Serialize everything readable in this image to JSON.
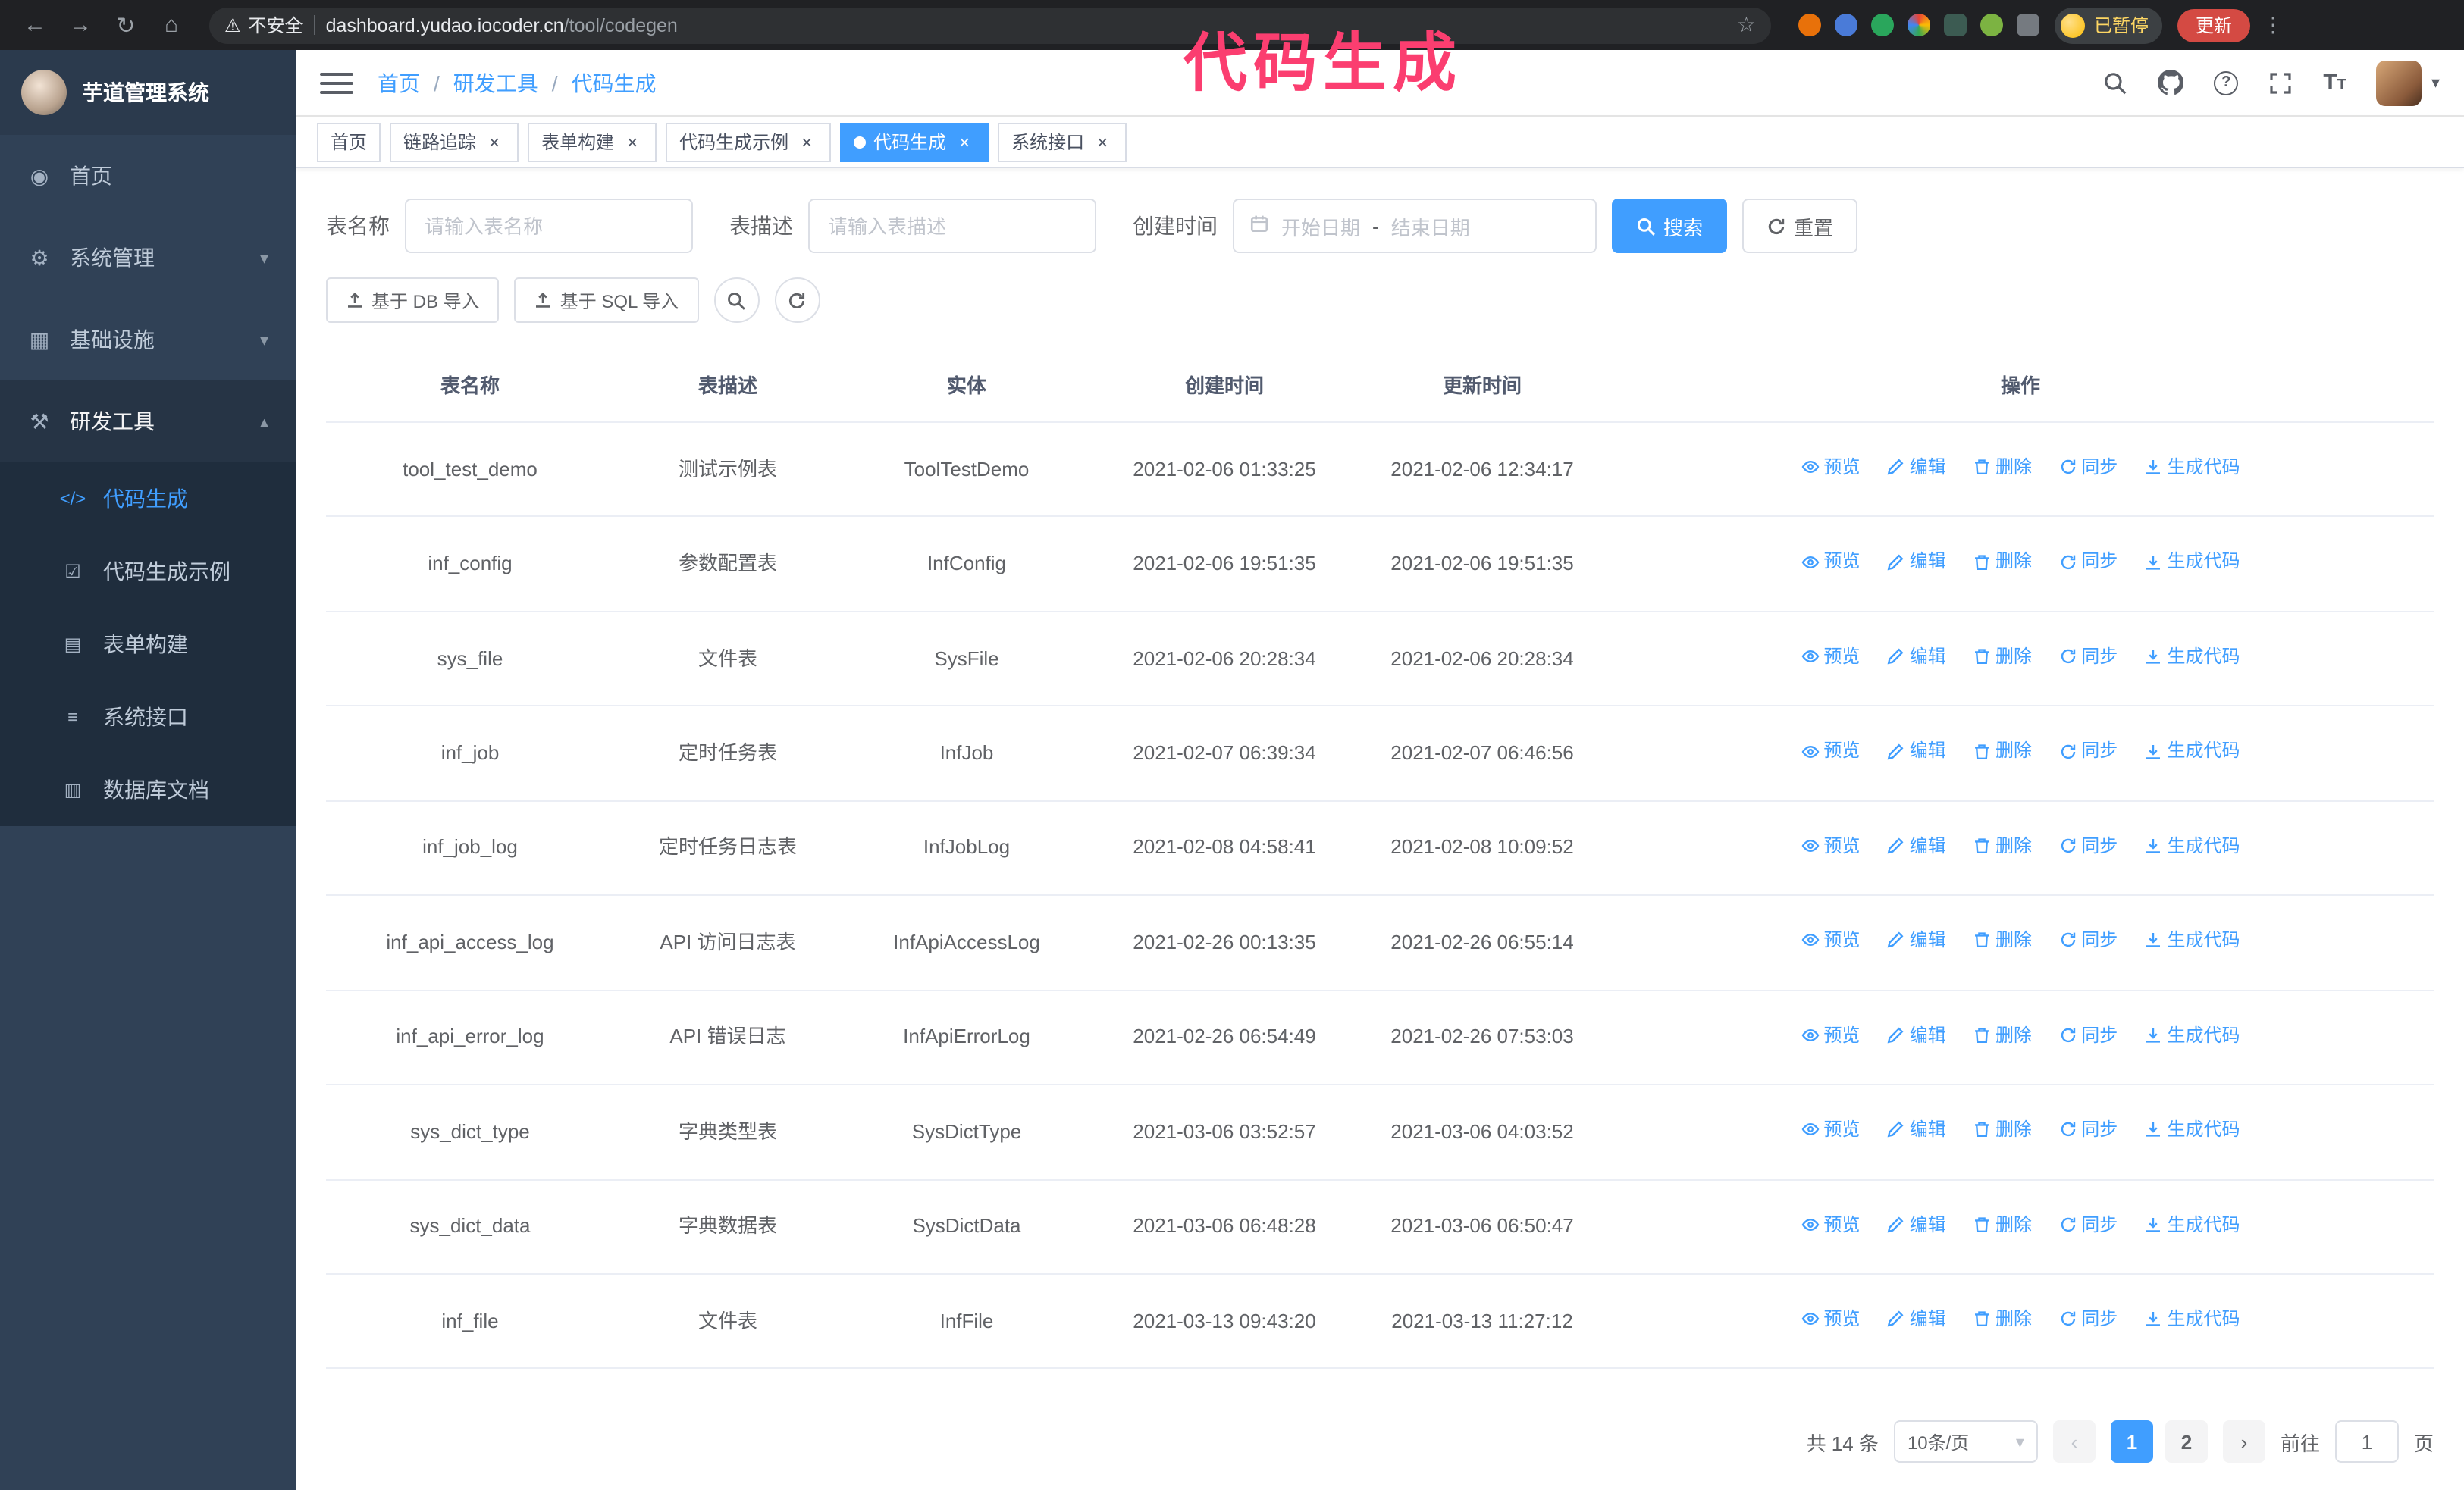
{
  "theme": {
    "primary": "#409eff",
    "annotation": "#fb3e70",
    "browser_bg": "#202124",
    "sidebar_bg": "#304156",
    "submenu_bg": "#1f2d3d",
    "sidebar_text": "#bfcbd9"
  },
  "browser": {
    "security_label": "不安全",
    "url_host": "dashboard.yudao.iocoder.cn",
    "url_path": "/tool/codegen",
    "paused_badge": "已暂停",
    "update_button": "更新"
  },
  "annotation": {
    "text": "代码生成"
  },
  "icons": {
    "back": "←",
    "forward": "→",
    "reload": "↻",
    "home": "⌂",
    "warning": "⚠",
    "star": "☆",
    "kebab": "⋮",
    "close": "×",
    "caret_down": "▾",
    "chevron_left": "‹",
    "chevron_right": "›",
    "question": "?",
    "font_large": "T",
    "font_small": "T"
  },
  "sidebar": {
    "logo_title": "芋道管理系统",
    "menu": [
      {
        "label": "首页",
        "icon": "◉"
      },
      {
        "label": "系统管理",
        "icon": "⚙",
        "chevron": "▾"
      },
      {
        "label": "基础设施",
        "icon": "▦",
        "chevron": "▾"
      },
      {
        "label": "研发工具",
        "icon": "⚒",
        "chevron": "▴",
        "expanded": true
      }
    ],
    "submenu": [
      {
        "label": "代码生成",
        "icon": "</>",
        "active": true
      },
      {
        "label": "代码生成示例",
        "icon": "☑"
      },
      {
        "label": "表单构建",
        "icon": "▤"
      },
      {
        "label": "系统接口",
        "icon": "≡"
      },
      {
        "label": "数据库文档",
        "icon": "▥"
      }
    ]
  },
  "header": {
    "breadcrumb": [
      {
        "label": "首页"
      },
      {
        "label": "研发工具"
      },
      {
        "label": "代码生成"
      }
    ]
  },
  "tabs": [
    {
      "label": "首页"
    },
    {
      "label": "链路追踪",
      "closable": true
    },
    {
      "label": "表单构建",
      "closable": true
    },
    {
      "label": "代码生成示例",
      "closable": true
    },
    {
      "label": "代码生成",
      "closable": true,
      "active": true
    },
    {
      "label": "系统接口",
      "closable": true
    }
  ],
  "filters": {
    "table_name_label": "表名称",
    "table_name_placeholder": "请输入表名称",
    "table_desc_label": "表描述",
    "table_desc_placeholder": "请输入表描述",
    "create_time_label": "创建时间",
    "date_start_placeholder": "开始日期",
    "date_separator": "-",
    "date_end_placeholder": "结束日期",
    "search_button": "搜索",
    "reset_button": "重置"
  },
  "toolbar": {
    "import_db_button": "基于 DB 导入",
    "import_sql_button": "基于 SQL 导入"
  },
  "table": {
    "columns": [
      "表名称",
      "表描述",
      "实体",
      "创建时间",
      "更新时间",
      "操作"
    ],
    "actions": [
      "预览",
      "编辑",
      "删除",
      "同步",
      "生成代码"
    ],
    "rows": [
      {
        "name": "tool_test_demo",
        "desc": "测试示例表",
        "entity": "ToolTestDemo",
        "created": "2021-02-06 01:33:25",
        "updated": "2021-02-06 12:34:17"
      },
      {
        "name": "inf_config",
        "desc": "参数配置表",
        "entity": "InfConfig",
        "created": "2021-02-06 19:51:35",
        "updated": "2021-02-06 19:51:35"
      },
      {
        "name": "sys_file",
        "desc": "文件表",
        "entity": "SysFile",
        "created": "2021-02-06 20:28:34",
        "updated": "2021-02-06 20:28:34"
      },
      {
        "name": "inf_job",
        "desc": "定时任务表",
        "entity": "InfJob",
        "created": "2021-02-07 06:39:34",
        "updated": "2021-02-07 06:46:56"
      },
      {
        "name": "inf_job_log",
        "desc": "定时任务日志表",
        "entity": "InfJobLog",
        "created": "2021-02-08 04:58:41",
        "updated": "2021-02-08 10:09:52"
      },
      {
        "name": "inf_api_access_log",
        "desc": "API 访问日志表",
        "entity": "InfApiAccessLog",
        "created": "2021-02-26 00:13:35",
        "updated": "2021-02-26 06:55:14"
      },
      {
        "name": "inf_api_error_log",
        "desc": "API 错误日志",
        "entity": "InfApiErrorLog",
        "created": "2021-02-26 06:54:49",
        "updated": "2021-02-26 07:53:03"
      },
      {
        "name": "sys_dict_type",
        "desc": "字典类型表",
        "entity": "SysDictType",
        "created": "2021-03-06 03:52:57",
        "updated": "2021-03-06 04:03:52"
      },
      {
        "name": "sys_dict_data",
        "desc": "字典数据表",
        "entity": "SysDictData",
        "created": "2021-03-06 06:48:28",
        "updated": "2021-03-06 06:50:47"
      },
      {
        "name": "inf_file",
        "desc": "文件表",
        "entity": "InfFile",
        "created": "2021-03-13 09:43:20",
        "updated": "2021-03-13 11:27:12"
      }
    ]
  },
  "pagination": {
    "total": "共 14 条",
    "page_size": "10条/页",
    "pages": [
      {
        "label": "1",
        "active": true
      },
      {
        "label": "2"
      }
    ],
    "goto_label": "前往",
    "goto_value": "1",
    "goto_suffix": "页"
  }
}
